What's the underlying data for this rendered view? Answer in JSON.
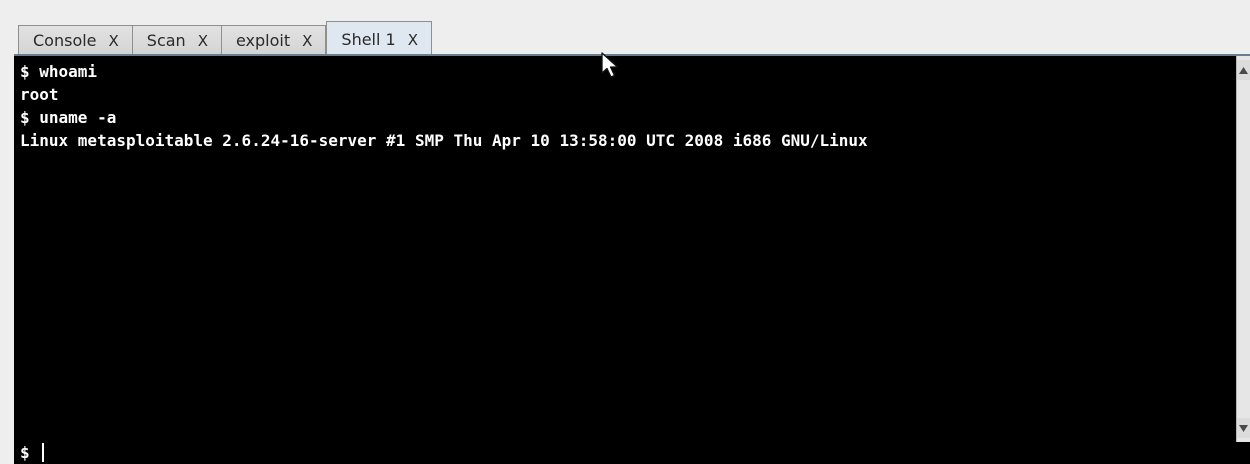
{
  "tabs": [
    {
      "label": "Console",
      "close": "X",
      "active": false
    },
    {
      "label": "Scan",
      "close": "X",
      "active": false
    },
    {
      "label": "exploit",
      "close": "X",
      "active": false
    },
    {
      "label": "Shell 1",
      "close": "X",
      "active": true
    }
  ],
  "terminal": {
    "lines": [
      "$ whoami",
      "root",
      "$ uname -a",
      "Linux metasploitable 2.6.24-16-server #1 SMP Thu Apr 10 13:58:00 UTC 2008 i686 GNU/Linux"
    ],
    "prompt": "$",
    "input_value": ""
  },
  "colors": {
    "terminal_bg": "#000000",
    "terminal_fg": "#ffffff",
    "active_tab": "#dfe8f0",
    "tab_underline": "#6a7d8e"
  },
  "icons": {
    "scroll_up": "scroll-up-arrow-icon",
    "scroll_down": "scroll-down-arrow-icon",
    "pointer": "mouse-pointer-icon"
  }
}
